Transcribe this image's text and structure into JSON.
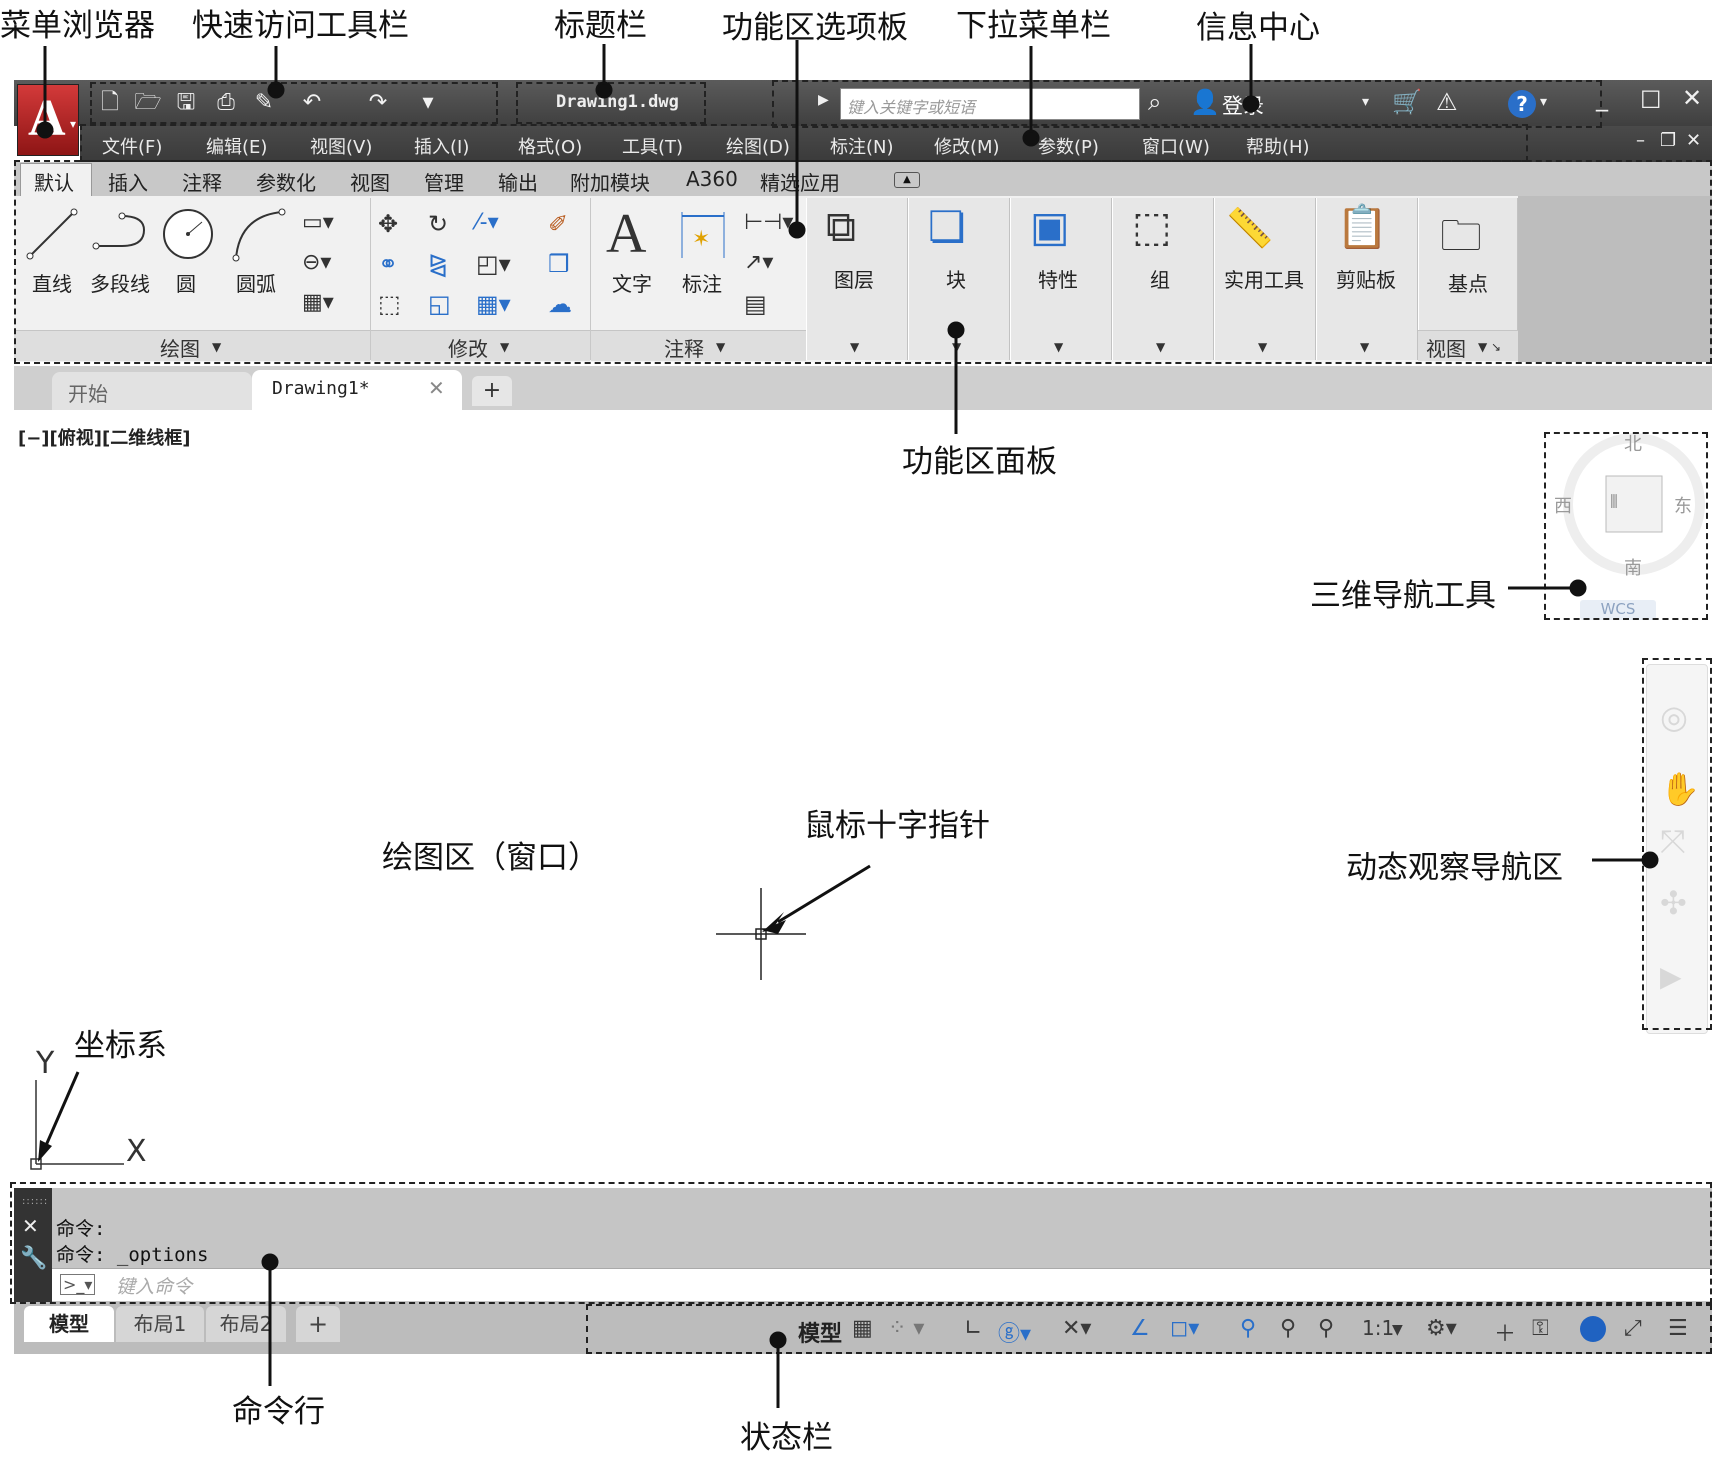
{
  "callouts": {
    "menu_browser": "菜单浏览器",
    "quick_access": "快速访问工具栏",
    "title_bar": "标题栏",
    "ribbon_tabs": "功能区选项板",
    "dropdown_menu": "下拉菜单栏",
    "info_center": "信息中心",
    "ribbon_panel": "功能区面板",
    "viewcube": "三维导航工具",
    "drawing_area": "绘图区（窗口）",
    "crosshair": "鼠标十字指针",
    "nav_bar": "动态观察导航区",
    "ucs": "坐标系",
    "command_line": "命令行",
    "status_bar": "状态栏"
  },
  "title_bar": {
    "file_name": "Drawing1.dwg",
    "search_placeholder": "键入关键字或短语",
    "login": "登录"
  },
  "menus": [
    "文件(F)",
    "编辑(E)",
    "视图(V)",
    "插入(I)",
    "格式(O)",
    "工具(T)",
    "绘图(D)",
    "标注(N)",
    "修改(M)",
    "参数(P)",
    "窗口(W)",
    "帮助(H)"
  ],
  "ribbon_tabs": [
    "默认",
    "插入",
    "注释",
    "参数化",
    "视图",
    "管理",
    "输出",
    "附加模块",
    "A360",
    "精选应用"
  ],
  "ribbon": {
    "draw_tools": [
      "直线",
      "多段线",
      "圆",
      "圆弧"
    ],
    "text_tools": [
      "文字",
      "标注"
    ],
    "big_buttons": [
      "图层",
      "块",
      "特性",
      "组",
      "实用工具",
      "剪贴板",
      "基点"
    ],
    "panel_titles": [
      "绘图",
      "修改",
      "注释",
      "视图"
    ]
  },
  "doc_tabs": [
    "开始",
    "Drawing1*"
  ],
  "viewport_label": "[−][俯视][二维线框]",
  "viewcube": {
    "north": "北",
    "south": "南",
    "east": "东",
    "west": "西",
    "wcs": "WCS"
  },
  "ucs_axes": {
    "x": "X",
    "y": "Y"
  },
  "command": {
    "line1": "命令:",
    "line2": "命令: _options",
    "placeholder": "键入命令"
  },
  "layout_tabs": [
    "模型",
    "布局1",
    "布局2"
  ],
  "status": {
    "model": "模型",
    "scale": "1:1"
  }
}
